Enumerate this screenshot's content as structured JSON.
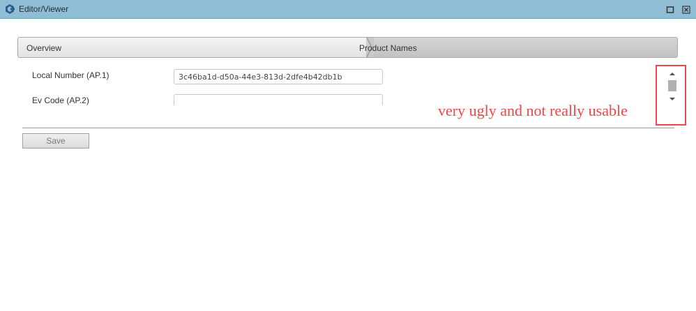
{
  "window": {
    "title": "Editor/Viewer",
    "icons": {
      "logo": "app-logo-icon",
      "maximize": "maximize-icon",
      "close": "close-icon"
    }
  },
  "breadcrumb": {
    "items": [
      {
        "label": "Overview",
        "active": false
      },
      {
        "label": "Product Names",
        "active": true
      }
    ]
  },
  "form": {
    "fields": [
      {
        "label": "Local Number (AP.1)",
        "value": "3c46ba1d-d50a-44e3-813d-2dfe4b42db1b"
      },
      {
        "label": "Ev Code (AP.2)",
        "value": ""
      }
    ],
    "save_label": "Save"
  },
  "annotation": {
    "text": "very ugly and not really usable",
    "color": "#e8494b"
  },
  "colors": {
    "titlebar": "#8fbdd6",
    "annotation": "#e8494b"
  }
}
